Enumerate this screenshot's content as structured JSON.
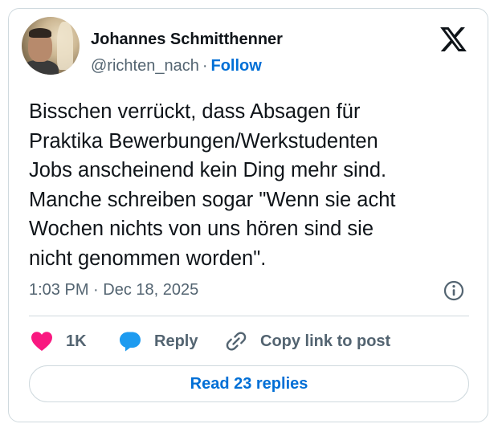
{
  "author": {
    "name": "Johannes Schmitthenner",
    "handle": "@richten_nach",
    "separator": "·",
    "follow_label": "Follow"
  },
  "logo": {
    "icon": "x-logo-icon"
  },
  "tweet": {
    "lines": [
      "Bisschen verrückt, dass Absagen für",
      "Praktika Bewerbungen/Werkstudenten",
      "Jobs anscheinend kein Ding mehr sind.",
      "Manche schreiben sogar \"Wenn sie acht",
      "Wochen nichts von uns hören sind sie",
      "nicht genommen worden\"."
    ]
  },
  "meta": {
    "time": "1:03 PM",
    "separator": "·",
    "date": "Dec 18, 2025",
    "info_icon": "info-icon"
  },
  "actions": {
    "like_count": "1K",
    "reply_label": "Reply",
    "copy_label": "Copy link to post"
  },
  "read_replies_label": "Read 23 replies",
  "colors": {
    "link": "#006fd6",
    "heart": "#f91880",
    "reply_bubble": "#1d9bf0",
    "muted": "#536471",
    "text": "#0f1419",
    "border": "#cfd9de"
  }
}
